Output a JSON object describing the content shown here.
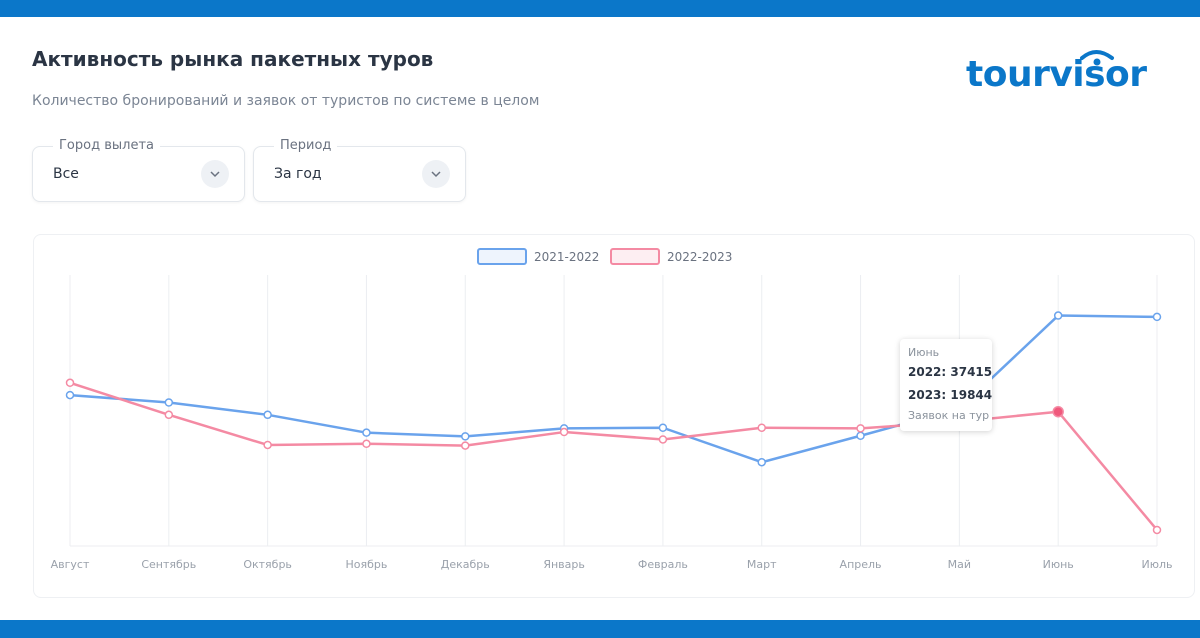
{
  "header": {
    "title": "Активность рынка пакетных туров",
    "subtitle": "Количество бронирований и заявок от туристов по системе в целом",
    "logo_text": "tourvisor"
  },
  "filters": {
    "city": {
      "label": "Город вылета",
      "value": "Все"
    },
    "period": {
      "label": "Период",
      "value": "За год"
    }
  },
  "colors": {
    "brand": "#0b77c9",
    "series_2021_2022": "#6aa3ec",
    "series_2022_2023": "#f48aa3"
  },
  "chart_data": {
    "type": "line",
    "categories": [
      "Август",
      "Сентябрь",
      "Октябрь",
      "Ноябрь",
      "Декабрь",
      "Январь",
      "Февраль",
      "Март",
      "Апрель",
      "Май",
      "Июнь",
      "Июль"
    ],
    "series": [
      {
        "name": "2021-2022",
        "values": [
          24500,
          23300,
          21300,
          18400,
          17800,
          19100,
          19200,
          13600,
          17900,
          22300,
          37415,
          37200
        ]
      },
      {
        "name": "2022-2023",
        "values": [
          26500,
          21300,
          16400,
          16600,
          16300,
          18500,
          17300,
          19200,
          19100,
          20200,
          21800,
          2600
        ]
      }
    ],
    "ylim": [
      0,
      44000
    ],
    "grid": "vertical",
    "legend": "top-center",
    "tooltip": {
      "title": "Июнь",
      "line1": "2022: 37415",
      "line2": "2023: 19844",
      "footer": "Заявок на тур"
    }
  }
}
